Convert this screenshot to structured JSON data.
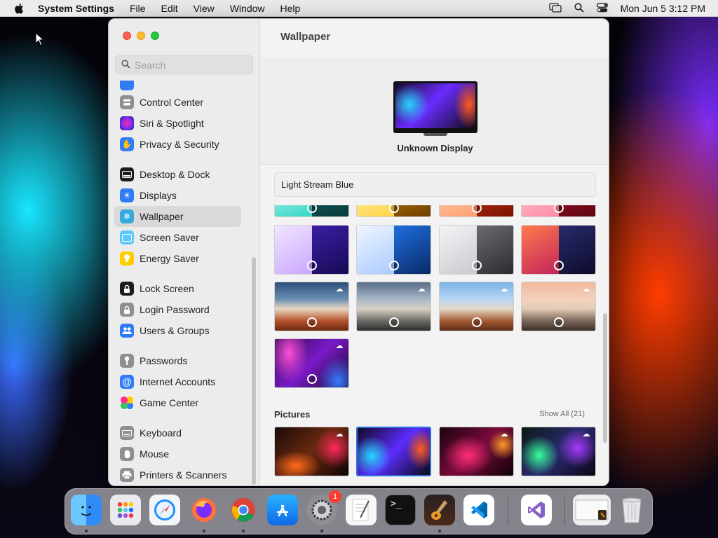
{
  "menubar": {
    "app_name": "System Settings",
    "items": [
      "File",
      "Edit",
      "View",
      "Window",
      "Help"
    ],
    "clock": "Mon Jun 5  3:12 PM"
  },
  "sidebar": {
    "search_placeholder": "Search",
    "items": [
      {
        "label": "Control Center",
        "icon": "control-center-icon",
        "color": "#8e8e93"
      },
      {
        "label": "Siri & Spotlight",
        "icon": "siri-icon",
        "color": "#b23cff"
      },
      {
        "label": "Privacy & Security",
        "icon": "hand-icon",
        "color": "#2f7cf6"
      },
      {
        "label": "Desktop & Dock",
        "icon": "dock-icon",
        "color": "#1c1c1e"
      },
      {
        "label": "Displays",
        "icon": "sun-icon",
        "color": "#2f7cf6"
      },
      {
        "label": "Wallpaper",
        "icon": "snowflake-icon",
        "color": "#34aadc"
      },
      {
        "label": "Screen Saver",
        "icon": "screen-saver-icon",
        "color": "#5ac8fa"
      },
      {
        "label": "Energy Saver",
        "icon": "lightbulb-icon",
        "color": "#ffcc00"
      },
      {
        "label": "Lock Screen",
        "icon": "lock-icon",
        "color": "#1c1c1e"
      },
      {
        "label": "Login Password",
        "icon": "padlock-icon",
        "color": "#8e8e93"
      },
      {
        "label": "Users & Groups",
        "icon": "users-icon",
        "color": "#2f7cf6"
      },
      {
        "label": "Passwords",
        "icon": "key-icon",
        "color": "#8e8e93"
      },
      {
        "label": "Internet Accounts",
        "icon": "at-icon",
        "color": "#2f7cf6"
      },
      {
        "label": "Game Center",
        "icon": "game-center-icon",
        "color": "#ff9500"
      },
      {
        "label": "Keyboard",
        "icon": "keyboard-icon",
        "color": "#8e8e93"
      },
      {
        "label": "Mouse",
        "icon": "mouse-icon",
        "color": "#8e8e93"
      },
      {
        "label": "Printers & Scanners",
        "icon": "printer-icon",
        "color": "#8e8e93"
      }
    ]
  },
  "main": {
    "title": "Wallpaper",
    "display_name": "Unknown Display",
    "wallpaper_name": "Light Stream Blue",
    "pictures_heading": "Pictures",
    "show_all": "Show All (21)"
  },
  "dock": {
    "items": [
      {
        "name": "finder-icon",
        "color": "#2f8cf6"
      },
      {
        "name": "launchpad-icon",
        "color": "#e9e9ee"
      },
      {
        "name": "safari-icon",
        "color": "#1e90ff"
      },
      {
        "name": "firefox-icon",
        "color": "#7b2cff"
      },
      {
        "name": "chrome-icon",
        "color": "#ffffff"
      },
      {
        "name": "app-store-icon",
        "color": "#1a8cff"
      },
      {
        "name": "system-settings-icon",
        "color": "#8e8e93"
      },
      {
        "name": "textedit-icon",
        "color": "#f2f2f2"
      },
      {
        "name": "terminal-icon",
        "color": "#111111"
      },
      {
        "name": "instruments-icon",
        "color": "#3b2a2a"
      },
      {
        "name": "vscode-icon",
        "color": "#ffffff"
      },
      {
        "name": "visual-studio-icon",
        "color": "#ffffff"
      },
      {
        "name": "preview-window-icon",
        "color": "#efefef"
      },
      {
        "name": "trash-icon",
        "color": "#e6e6e6"
      }
    ],
    "settings_badge": "1"
  }
}
